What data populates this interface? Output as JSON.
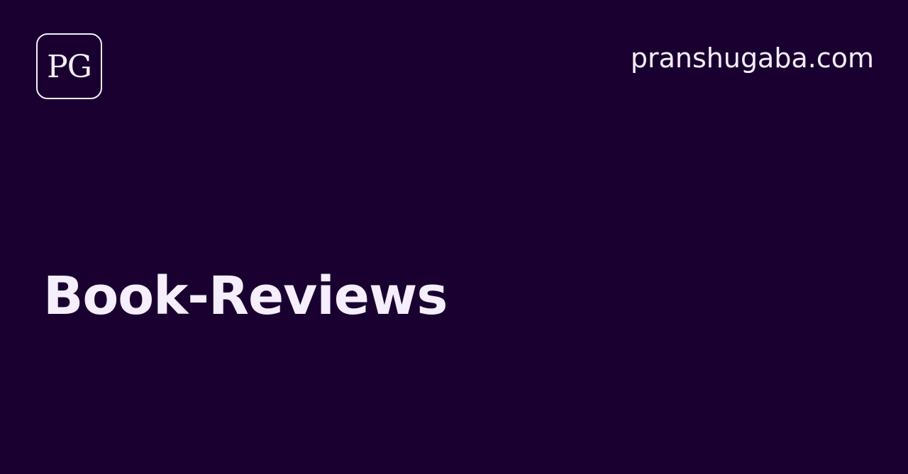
{
  "logo": {
    "text": "PG"
  },
  "header": {
    "site": "pranshugaba.com"
  },
  "main": {
    "title": "Book-Reviews"
  },
  "colors": {
    "background": "#190030",
    "foreground": "#f5eefc"
  }
}
